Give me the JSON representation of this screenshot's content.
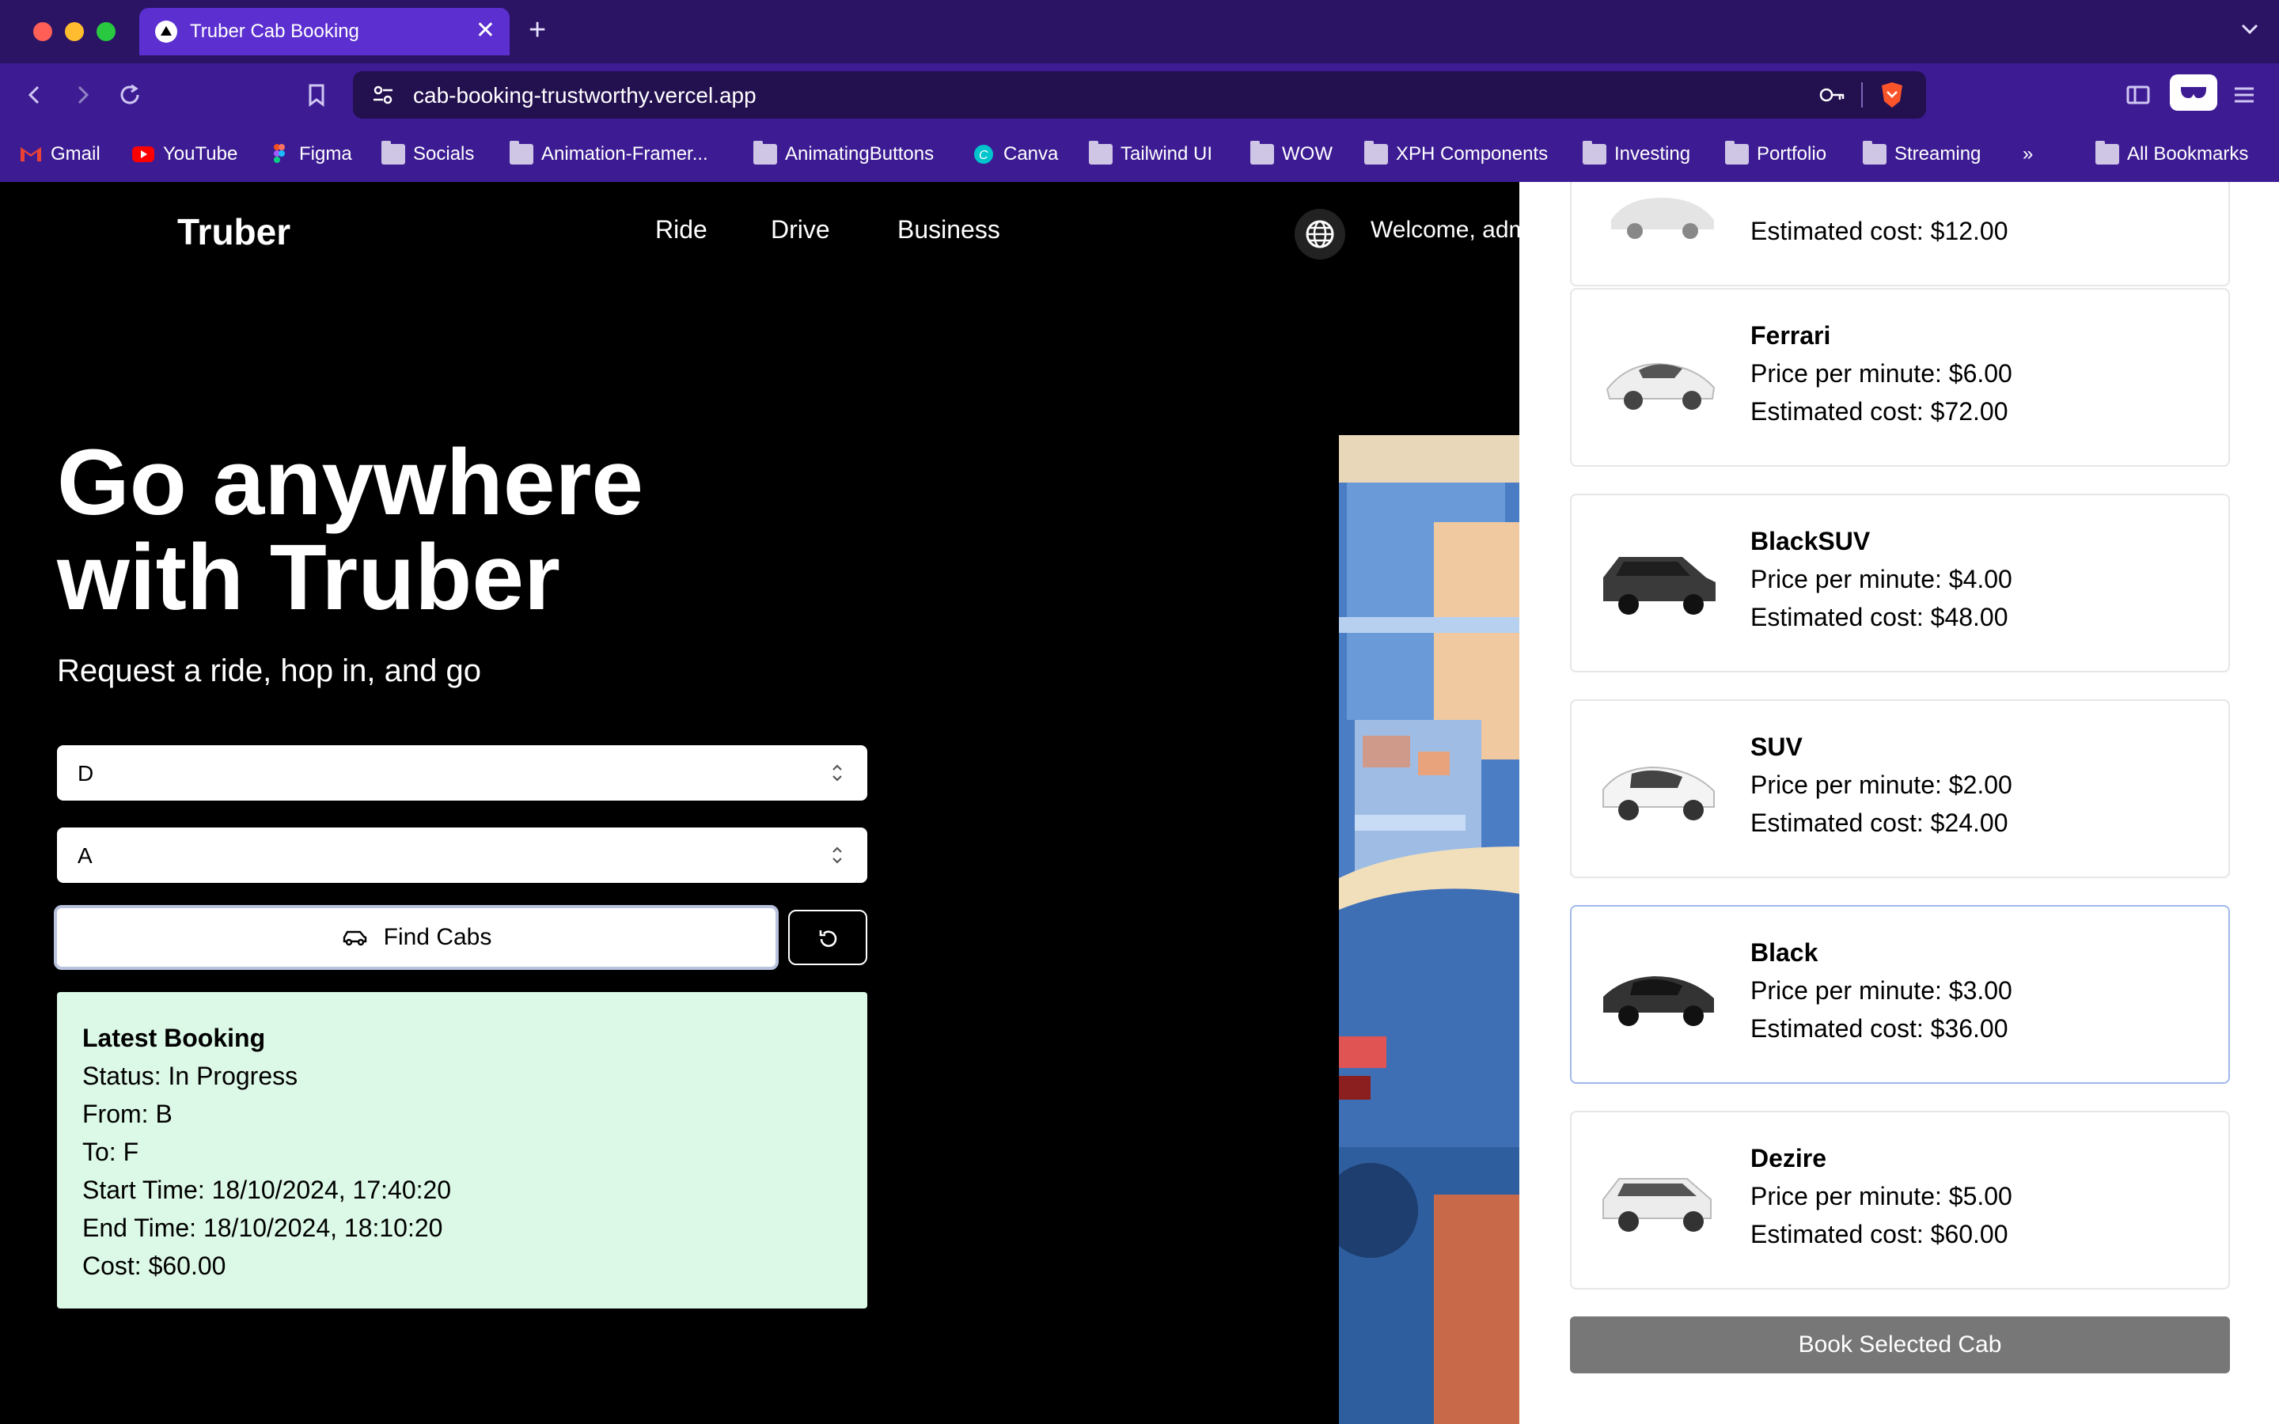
{
  "browser": {
    "tab_title": "Truber Cab Booking",
    "url": "cab-booking-trustworthy.vercel.app",
    "bookmarks": [
      "Gmail",
      "YouTube",
      "Figma",
      "Socials",
      "Animation-Framer...",
      "AnimatingButtons",
      "Canva",
      "Tailwind UI",
      "WOW",
      "XPH Components",
      "Investing",
      "Portfolio",
      "Streaming"
    ],
    "all_bookmarks": "All Bookmarks"
  },
  "nav": {
    "logo": "Truber",
    "links": [
      "Ride",
      "Drive",
      "Business"
    ],
    "welcome": "Welcome, adm"
  },
  "hero": {
    "title_line1": "Go anywhere",
    "title_line2": "with Truber",
    "subtitle": "Request a ride, hop in, and go"
  },
  "form": {
    "pickup_value": "D",
    "dropoff_value": "A",
    "find_label": "Find Cabs"
  },
  "booking": {
    "title": "Latest Booking",
    "status": "Status: In Progress",
    "from": "From: B",
    "to": "To: F",
    "start": "Start Time: 18/10/2024, 17:40:20",
    "end": "End Time: 18/10/2024, 18:10:20",
    "cost": "Cost: $60.00"
  },
  "drawer": {
    "partial_cost": "Estimated cost: $12.00",
    "cabs": [
      {
        "name": "Ferrari",
        "price": "Price per minute: $6.00",
        "cost": "Estimated cost: $72.00",
        "color": "#e8e8e8"
      },
      {
        "name": "BlackSUV",
        "price": "Price per minute: $4.00",
        "cost": "Estimated cost: $48.00",
        "color": "#3a3a3a"
      },
      {
        "name": "SUV",
        "price": "Price per minute: $2.00",
        "cost": "Estimated cost: $24.00",
        "color": "#f2f2f2"
      },
      {
        "name": "Black",
        "price": "Price per minute: $3.00",
        "cost": "Estimated cost: $36.00",
        "color": "#333333"
      },
      {
        "name": "Dezire",
        "price": "Price per minute: $5.00",
        "cost": "Estimated cost: $60.00",
        "color": "#ececec"
      }
    ],
    "selected": "Black",
    "book_label": "Book Selected Cab"
  }
}
